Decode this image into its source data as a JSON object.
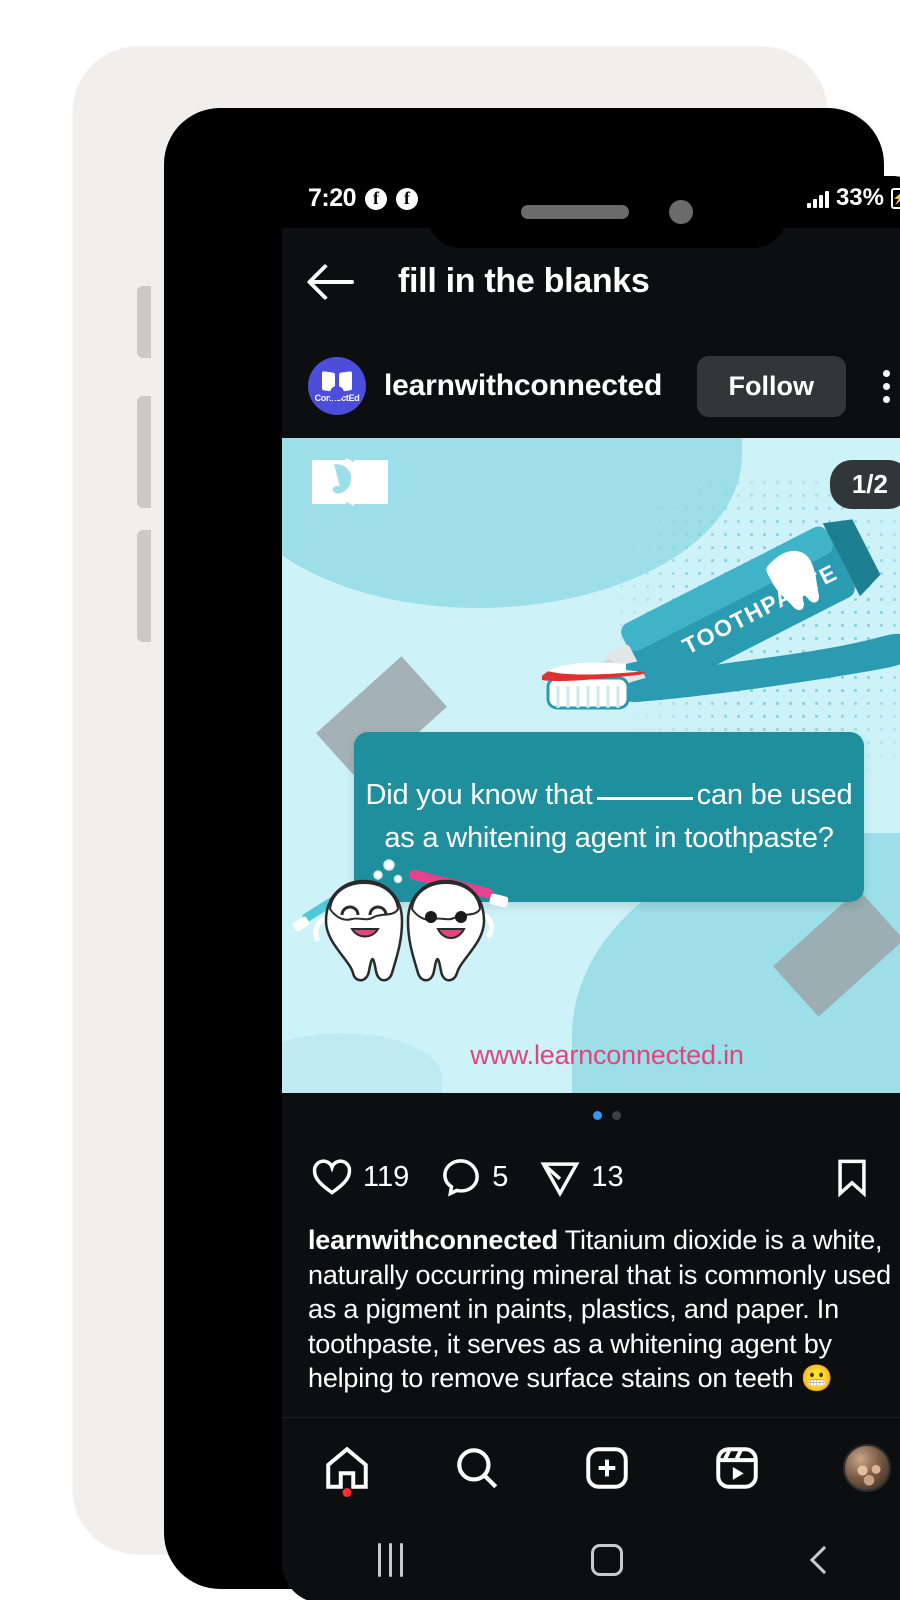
{
  "status_bar": {
    "time": "7:20",
    "app_icon_1": "facebook-icon",
    "app_icon_2": "facebook-messenger-icon",
    "battery_percent": "33%",
    "battery_state": "charging"
  },
  "header": {
    "back_label": "back-arrow",
    "title": "fill in the blanks"
  },
  "post": {
    "avatar_label": "ConnectEd",
    "username": "learnwithconnected",
    "follow_label": "Follow",
    "more_label": "More options",
    "carousel_badge": "1/2",
    "carousel_current": 1,
    "carousel_total": 2,
    "image": {
      "tube_label": "TOOTHPASTE",
      "quiz_line_1_before": "Did you know that",
      "quiz_line_1_after": "can be used",
      "quiz_line_2": "as a whitening agent in toothpaste?",
      "website": "www.learnconnected.in",
      "bg_color": "#cdf2f7",
      "accent_color": "#1f8f9d",
      "url_color": "#e0457b"
    }
  },
  "actions": {
    "like_count": "119",
    "comment_count": "5",
    "share_count": "13",
    "save_label": "Save"
  },
  "caption": {
    "username": "learnwithconnected",
    "text": " Titanium dioxide is a white, naturally occurring mineral that is commonly used as a pigment in paints, plastics, and paper. In toothpaste, it serves as a whitening agent by helping to remove surface stains on teeth ",
    "emoji": "😬"
  },
  "bottom_nav": {
    "items": [
      {
        "name": "home",
        "badge": true
      },
      {
        "name": "search",
        "badge": false
      },
      {
        "name": "create",
        "badge": false
      },
      {
        "name": "reels",
        "badge": false
      },
      {
        "name": "profile",
        "badge": false
      }
    ]
  },
  "android_nav": {
    "recents_label": "Recents",
    "home_label": "Home",
    "back_label": "Back"
  },
  "theme": {
    "app_bg": "#0d0e10",
    "accent_blue": "#3897f0",
    "follow_bg": "#343536",
    "avatar_bg": "#4c4ddb"
  }
}
